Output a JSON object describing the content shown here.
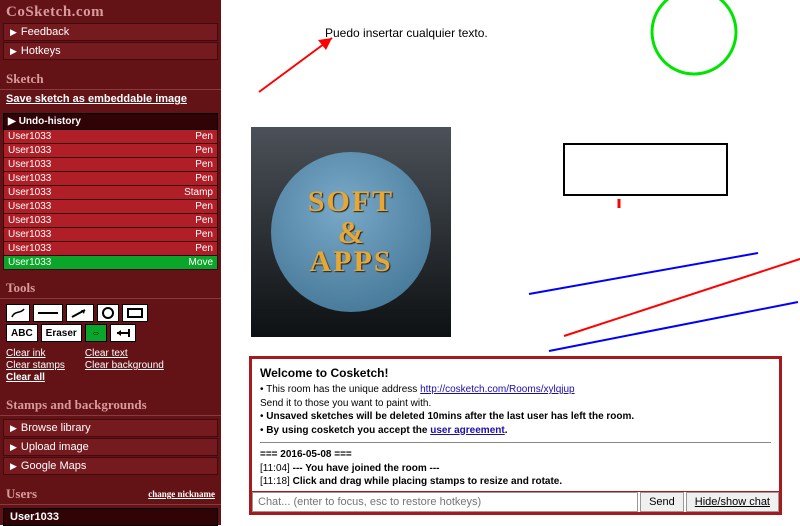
{
  "app": {
    "title": "CoSketch.com"
  },
  "topmenu": [
    {
      "label": "Feedback",
      "name": "menu-feedback"
    },
    {
      "label": "Hotkeys",
      "name": "menu-hotkeys"
    }
  ],
  "sketch": {
    "header": "Sketch",
    "save_link": "Save sketch as embeddable image",
    "undo_header": "Undo-history",
    "undo": [
      {
        "user": "User1033",
        "action": "Pen"
      },
      {
        "user": "User1033",
        "action": "Pen"
      },
      {
        "user": "User1033",
        "action": "Pen"
      },
      {
        "user": "User1033",
        "action": "Pen"
      },
      {
        "user": "User1033",
        "action": "Stamp"
      },
      {
        "user": "User1033",
        "action": "Pen"
      },
      {
        "user": "User1033",
        "action": "Pen"
      },
      {
        "user": "User1033",
        "action": "Pen"
      },
      {
        "user": "User1033",
        "action": "Pen"
      },
      {
        "user": "User1033",
        "action": "Move",
        "selected": true
      }
    ]
  },
  "tools": {
    "header": "Tools",
    "row1_icons": [
      "pen",
      "line",
      "arrow",
      "circle",
      "rect"
    ],
    "row2": [
      {
        "label": "ABC",
        "name": "text-tool"
      },
      {
        "label": "Eraser",
        "name": "eraser-tool"
      },
      {
        "label": "⇔",
        "name": "move-tool",
        "selected": true
      },
      {
        "label": "↤",
        "name": "pan-tool"
      }
    ],
    "links": {
      "clear_ink": "Clear ink",
      "clear_stamps": "Clear stamps",
      "clear_all": "Clear all",
      "clear_text": "Clear text",
      "clear_bg": "Clear background"
    }
  },
  "stamps": {
    "header": "Stamps and backgrounds",
    "items": [
      {
        "label": "Browse library",
        "name": "stamps-browse"
      },
      {
        "label": "Upload image",
        "name": "stamps-upload"
      },
      {
        "label": "Google Maps",
        "name": "stamps-gmaps"
      }
    ]
  },
  "users": {
    "header": "Users",
    "change_nick": "change nickname",
    "list": [
      "User1033"
    ]
  },
  "canvas": {
    "text1": "Puedo insertar cualquier texto.",
    "stamp_top": "Soft",
    "stamp_mid": "&",
    "stamp_bot": "Apps"
  },
  "chat": {
    "welcome_title": "Welcome to Cosketch!",
    "line_addr_pre": "This room has the unique address ",
    "room_url": "http://cosketch.com/Rooms/xylqjup",
    "line_send": "Send it to those you want to paint with.",
    "line_unsaved": "Unsaved sketches will be deleted 10mins after the last user has left the room.",
    "line_agree_pre": "By using cosketch you accept the ",
    "line_agree_link": "user agreement",
    "date": "=== 2016-05-08 ===",
    "msg1_time": "[11:04]",
    "msg1_text": "--- You have joined the room ---",
    "msg2_time": "[11:18]",
    "msg2_text": "Click and drag while placing stamps to resize and rotate.",
    "placeholder": "Chat... (enter to focus, esc to restore hotkeys)",
    "send": "Send",
    "toggle": "Hide/show chat"
  }
}
